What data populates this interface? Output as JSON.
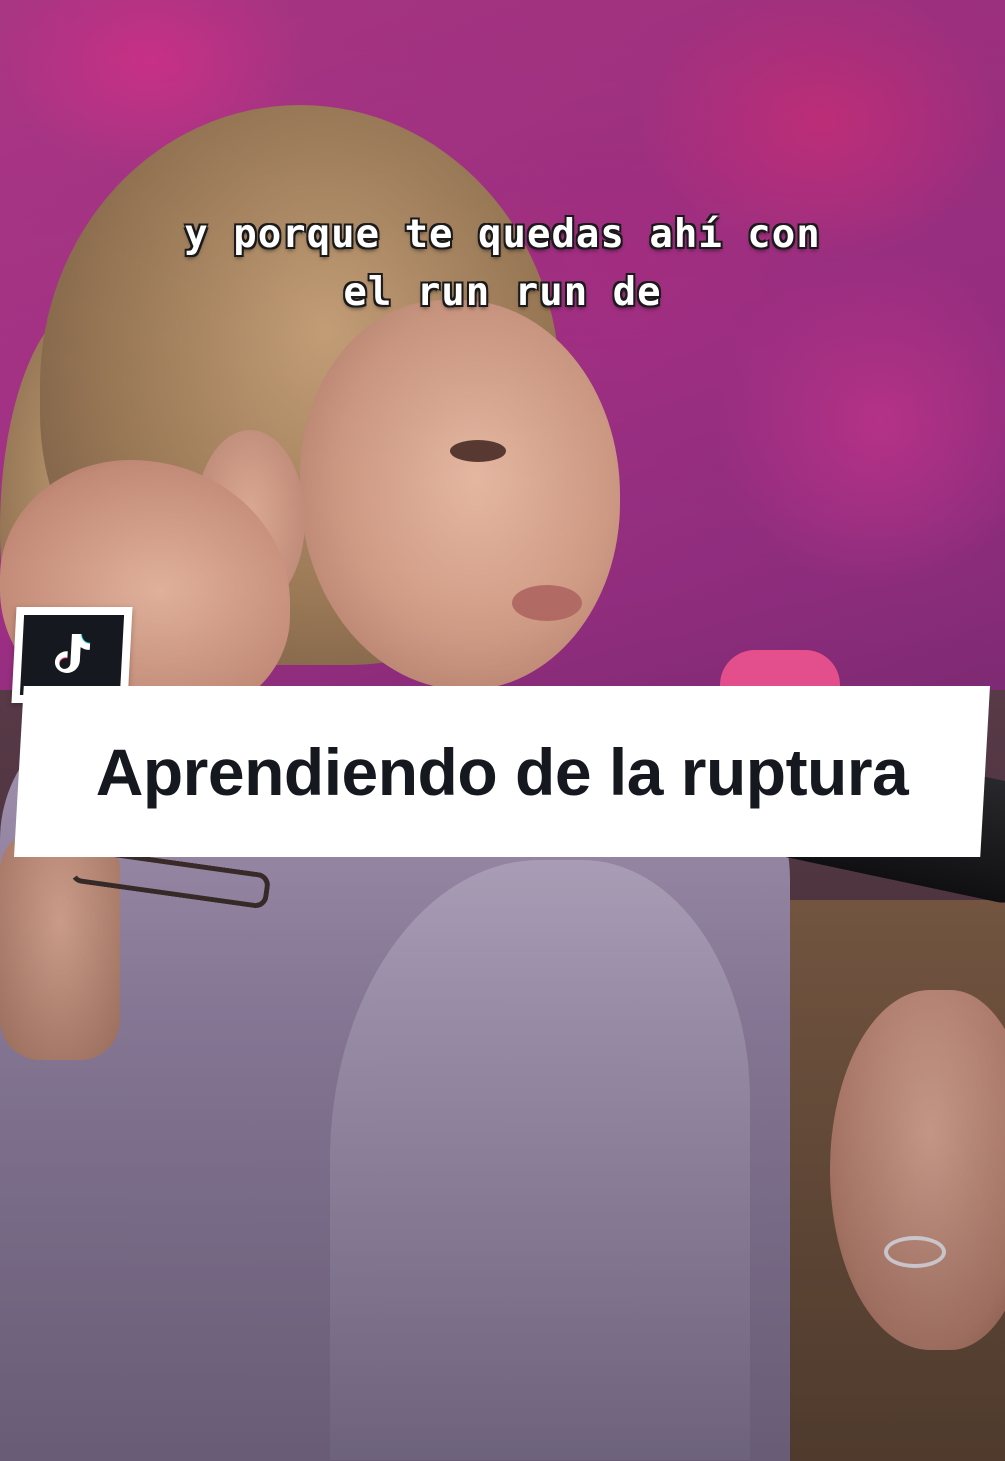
{
  "caption": {
    "line1": "y porque te quedas ahí con",
    "line2": "el run run de"
  },
  "badge": {
    "icon": "tiktok-icon"
  },
  "banner": {
    "title": "Aprendiendo de la ruptura"
  },
  "colors": {
    "banner_bg": "#ffffff",
    "banner_text": "#15181f",
    "badge_bg": "#15181f",
    "caption_text": "#ffffff",
    "backdrop_pink": "#b73a8e"
  }
}
